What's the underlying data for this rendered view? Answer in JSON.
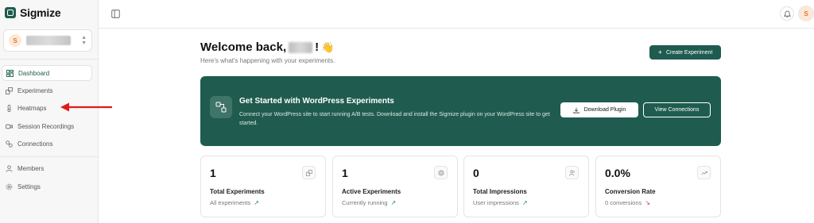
{
  "app": {
    "name": "Sigmize"
  },
  "workspace": {
    "avatar_letter": "S"
  },
  "sidebar": {
    "items": [
      {
        "label": "Dashboard",
        "icon": "dashboard-icon",
        "active": true
      },
      {
        "label": "Experiments",
        "icon": "experiments-icon",
        "active": false
      },
      {
        "label": "Heatmaps",
        "icon": "thermometer-icon",
        "active": false
      },
      {
        "label": "Session Recordings",
        "icon": "video-icon",
        "active": false
      },
      {
        "label": "Connections",
        "icon": "link-icon",
        "active": false
      },
      {
        "label": "Members",
        "icon": "users-icon",
        "active": false
      },
      {
        "label": "Settings",
        "icon": "gear-icon",
        "active": false
      }
    ]
  },
  "topbar": {
    "avatar_letter": "S"
  },
  "header": {
    "welcome": "Welcome back,",
    "exclaim": "!",
    "wave_emoji": "👋",
    "subtitle": "Here's what's happening with your experiments.",
    "create_label": "Create Experiment"
  },
  "banner": {
    "title": "Get Started with WordPress Experiments",
    "description": "Connect your WordPress site to start running A/B tests. Download and install the Sigmize plugin on your WordPress site to get started.",
    "download_label": "Download Plugin",
    "view_label": "View Connections"
  },
  "stats": [
    {
      "value": "1",
      "label": "Total Experiments",
      "sub": "All experiments",
      "trend": "↗",
      "icon": "experiments-icon"
    },
    {
      "value": "1",
      "label": "Active Experiments",
      "sub": "Currently running",
      "trend": "↗",
      "icon": "target-icon"
    },
    {
      "value": "0",
      "label": "Total Impressions",
      "sub": "User impressions",
      "trend": "↗",
      "icon": "users-icon"
    },
    {
      "value": "0.0%",
      "label": "Conversion Rate",
      "sub": "0 conversions",
      "trend": "↘",
      "icon": "trending-icon"
    }
  ],
  "colors": {
    "brand": "#1f5c4f",
    "arrow": "#e01b1b",
    "trend_up": "#1f8f6a",
    "trend_down": "#d23b3b"
  }
}
